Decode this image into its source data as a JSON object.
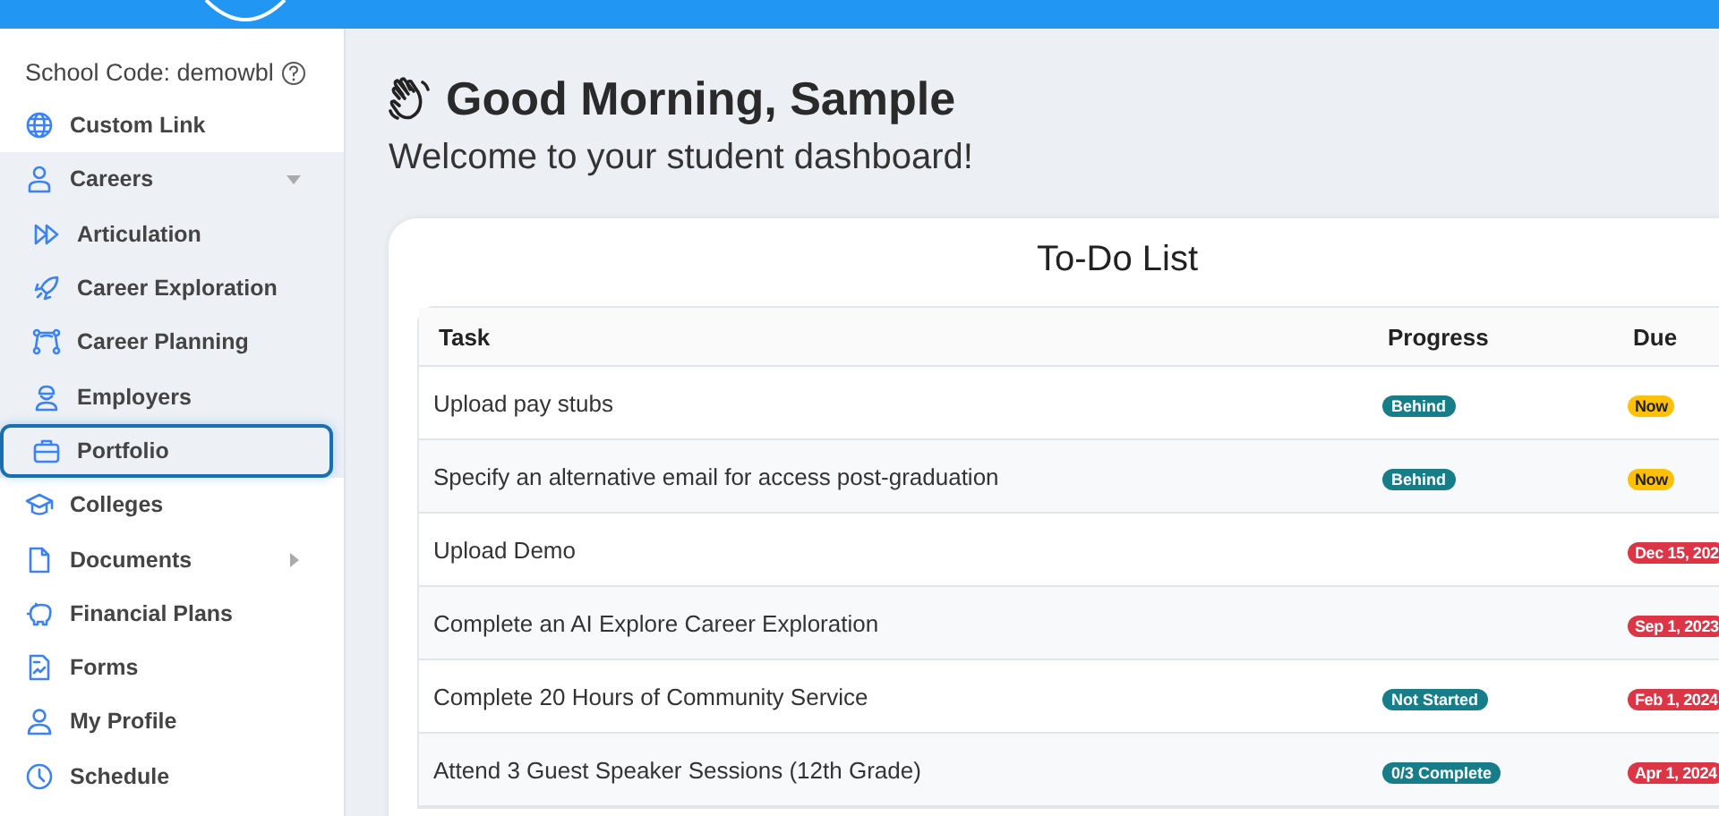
{
  "sidebar": {
    "school_code": "School Code: demowbl",
    "items": [
      {
        "label": "Custom Link",
        "selected": false
      },
      {
        "label": "Careers",
        "selected": false,
        "expanded": true,
        "children": [
          {
            "label": "Articulation",
            "selected": false
          },
          {
            "label": "Career Exploration",
            "selected": false
          },
          {
            "label": "Career Planning",
            "selected": false
          },
          {
            "label": "Employers",
            "selected": false
          },
          {
            "label": "Portfolio",
            "selected": true
          }
        ]
      },
      {
        "label": "Colleges",
        "selected": false
      },
      {
        "label": "Documents",
        "selected": false,
        "expanded": false
      },
      {
        "label": "Financial Plans",
        "selected": false
      },
      {
        "label": "Forms",
        "selected": false
      },
      {
        "label": "My Profile",
        "selected": false
      },
      {
        "label": "Schedule",
        "selected": false
      }
    ]
  },
  "greeting": "Good Morning, Sample",
  "subtitle": "Welcome to your student dashboard!",
  "todo": {
    "title": "To-Do List",
    "columns": [
      "Task",
      "Progress",
      "Due"
    ],
    "rows": [
      {
        "task": "Upload pay stubs",
        "progress": "Behind",
        "due": "Now",
        "color": "#ffc107"
      },
      {
        "task": "Specify an alternative email for access post-graduation",
        "progress": "Behind",
        "due": "Now",
        "color": "#ffc107"
      },
      {
        "task": "Upload Demo",
        "due": "Dec 15, 202",
        "color": "#dc3545"
      },
      {
        "task": "Complete an AI Explore Career Exploration",
        "due": "Sep 1, 2023",
        "color": "#dc3545"
      },
      {
        "task": "Complete 20 Hours of Community Service",
        "progress": "Not Started",
        "due": "Feb 1, 2024",
        "color": "#dc3545"
      },
      {
        "task": "Attend 3 Guest Speaker Sessions (12th Grade)",
        "progress": "0/3 Complete",
        "due": "Apr 1, 2024",
        "color": "#dc3545"
      }
    ]
  }
}
